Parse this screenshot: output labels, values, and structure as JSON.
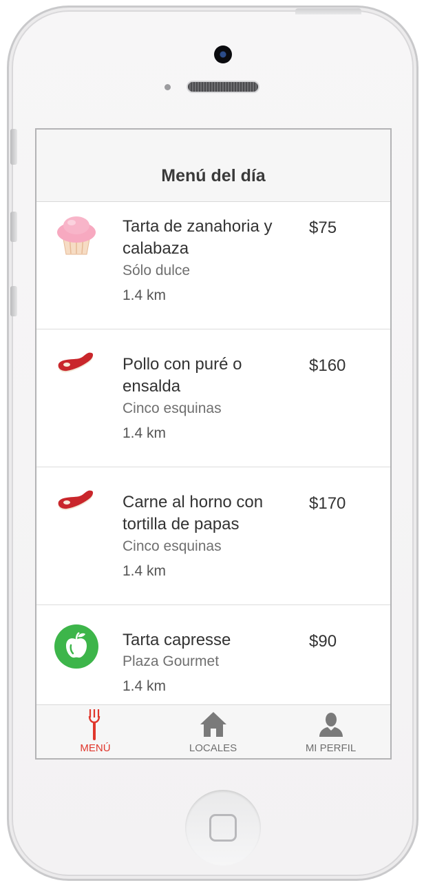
{
  "colors": {
    "accent": "#e0372c",
    "tab_inactive": "#6f6f6f",
    "apple_green": "#3db54a"
  },
  "header": {
    "title": "Menú del día"
  },
  "menu_items": [
    {
      "title": "Tarta de zanahoria y calabaza",
      "place": "Sólo dulce",
      "distance": "1.4 km",
      "price": "$75",
      "icon": "cupcake-icon"
    },
    {
      "title": "Pollo con puré o ensalda",
      "place": "Cinco esquinas",
      "distance": "1.4 km",
      "price": "$160",
      "icon": "meat-icon"
    },
    {
      "title": "Carne al horno con tortilla de papas",
      "place": "Cinco esquinas",
      "distance": "1.4 km",
      "price": "$170",
      "icon": "meat-icon"
    },
    {
      "title": "Tarta capresse",
      "place": "Plaza Gourmet",
      "distance": "1.4 km",
      "price": "$90",
      "icon": "apple-icon"
    }
  ],
  "tabs": [
    {
      "label": "MENÚ",
      "icon": "fork-icon",
      "active": true
    },
    {
      "label": "LOCALES",
      "icon": "home-icon",
      "active": false
    },
    {
      "label": "MI PERFIL",
      "icon": "user-icon",
      "active": false
    }
  ]
}
